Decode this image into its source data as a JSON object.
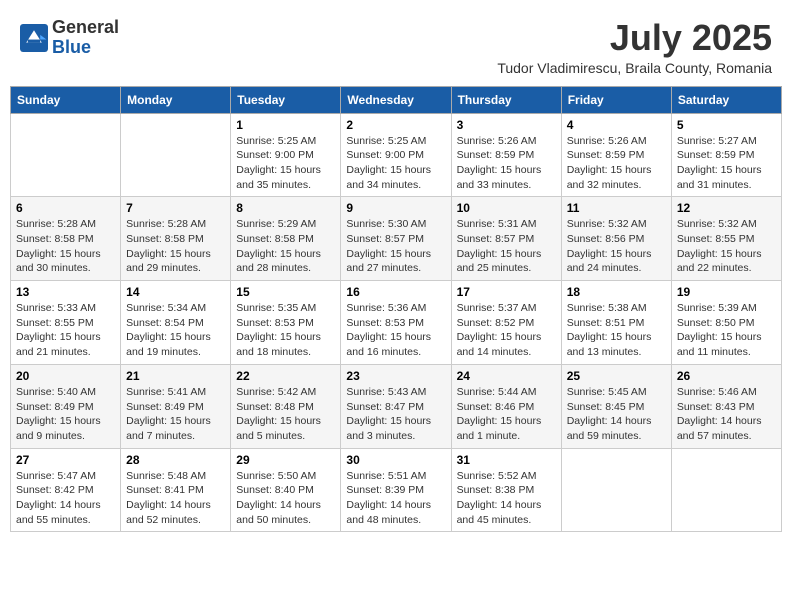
{
  "logo": {
    "general": "General",
    "blue": "Blue"
  },
  "title": {
    "month": "July 2025",
    "location": "Tudor Vladimirescu, Braila County, Romania"
  },
  "weekdays": [
    "Sunday",
    "Monday",
    "Tuesday",
    "Wednesday",
    "Thursday",
    "Friday",
    "Saturday"
  ],
  "weeks": [
    [
      {
        "day": null,
        "sunrise": null,
        "sunset": null,
        "daylight": null
      },
      {
        "day": null,
        "sunrise": null,
        "sunset": null,
        "daylight": null
      },
      {
        "day": "1",
        "sunrise": "Sunrise: 5:25 AM",
        "sunset": "Sunset: 9:00 PM",
        "daylight": "Daylight: 15 hours and 35 minutes."
      },
      {
        "day": "2",
        "sunrise": "Sunrise: 5:25 AM",
        "sunset": "Sunset: 9:00 PM",
        "daylight": "Daylight: 15 hours and 34 minutes."
      },
      {
        "day": "3",
        "sunrise": "Sunrise: 5:26 AM",
        "sunset": "Sunset: 8:59 PM",
        "daylight": "Daylight: 15 hours and 33 minutes."
      },
      {
        "day": "4",
        "sunrise": "Sunrise: 5:26 AM",
        "sunset": "Sunset: 8:59 PM",
        "daylight": "Daylight: 15 hours and 32 minutes."
      },
      {
        "day": "5",
        "sunrise": "Sunrise: 5:27 AM",
        "sunset": "Sunset: 8:59 PM",
        "daylight": "Daylight: 15 hours and 31 minutes."
      }
    ],
    [
      {
        "day": "6",
        "sunrise": "Sunrise: 5:28 AM",
        "sunset": "Sunset: 8:58 PM",
        "daylight": "Daylight: 15 hours and 30 minutes."
      },
      {
        "day": "7",
        "sunrise": "Sunrise: 5:28 AM",
        "sunset": "Sunset: 8:58 PM",
        "daylight": "Daylight: 15 hours and 29 minutes."
      },
      {
        "day": "8",
        "sunrise": "Sunrise: 5:29 AM",
        "sunset": "Sunset: 8:58 PM",
        "daylight": "Daylight: 15 hours and 28 minutes."
      },
      {
        "day": "9",
        "sunrise": "Sunrise: 5:30 AM",
        "sunset": "Sunset: 8:57 PM",
        "daylight": "Daylight: 15 hours and 27 minutes."
      },
      {
        "day": "10",
        "sunrise": "Sunrise: 5:31 AM",
        "sunset": "Sunset: 8:57 PM",
        "daylight": "Daylight: 15 hours and 25 minutes."
      },
      {
        "day": "11",
        "sunrise": "Sunrise: 5:32 AM",
        "sunset": "Sunset: 8:56 PM",
        "daylight": "Daylight: 15 hours and 24 minutes."
      },
      {
        "day": "12",
        "sunrise": "Sunrise: 5:32 AM",
        "sunset": "Sunset: 8:55 PM",
        "daylight": "Daylight: 15 hours and 22 minutes."
      }
    ],
    [
      {
        "day": "13",
        "sunrise": "Sunrise: 5:33 AM",
        "sunset": "Sunset: 8:55 PM",
        "daylight": "Daylight: 15 hours and 21 minutes."
      },
      {
        "day": "14",
        "sunrise": "Sunrise: 5:34 AM",
        "sunset": "Sunset: 8:54 PM",
        "daylight": "Daylight: 15 hours and 19 minutes."
      },
      {
        "day": "15",
        "sunrise": "Sunrise: 5:35 AM",
        "sunset": "Sunset: 8:53 PM",
        "daylight": "Daylight: 15 hours and 18 minutes."
      },
      {
        "day": "16",
        "sunrise": "Sunrise: 5:36 AM",
        "sunset": "Sunset: 8:53 PM",
        "daylight": "Daylight: 15 hours and 16 minutes."
      },
      {
        "day": "17",
        "sunrise": "Sunrise: 5:37 AM",
        "sunset": "Sunset: 8:52 PM",
        "daylight": "Daylight: 15 hours and 14 minutes."
      },
      {
        "day": "18",
        "sunrise": "Sunrise: 5:38 AM",
        "sunset": "Sunset: 8:51 PM",
        "daylight": "Daylight: 15 hours and 13 minutes."
      },
      {
        "day": "19",
        "sunrise": "Sunrise: 5:39 AM",
        "sunset": "Sunset: 8:50 PM",
        "daylight": "Daylight: 15 hours and 11 minutes."
      }
    ],
    [
      {
        "day": "20",
        "sunrise": "Sunrise: 5:40 AM",
        "sunset": "Sunset: 8:49 PM",
        "daylight": "Daylight: 15 hours and 9 minutes."
      },
      {
        "day": "21",
        "sunrise": "Sunrise: 5:41 AM",
        "sunset": "Sunset: 8:49 PM",
        "daylight": "Daylight: 15 hours and 7 minutes."
      },
      {
        "day": "22",
        "sunrise": "Sunrise: 5:42 AM",
        "sunset": "Sunset: 8:48 PM",
        "daylight": "Daylight: 15 hours and 5 minutes."
      },
      {
        "day": "23",
        "sunrise": "Sunrise: 5:43 AM",
        "sunset": "Sunset: 8:47 PM",
        "daylight": "Daylight: 15 hours and 3 minutes."
      },
      {
        "day": "24",
        "sunrise": "Sunrise: 5:44 AM",
        "sunset": "Sunset: 8:46 PM",
        "daylight": "Daylight: 15 hours and 1 minute."
      },
      {
        "day": "25",
        "sunrise": "Sunrise: 5:45 AM",
        "sunset": "Sunset: 8:45 PM",
        "daylight": "Daylight: 14 hours and 59 minutes."
      },
      {
        "day": "26",
        "sunrise": "Sunrise: 5:46 AM",
        "sunset": "Sunset: 8:43 PM",
        "daylight": "Daylight: 14 hours and 57 minutes."
      }
    ],
    [
      {
        "day": "27",
        "sunrise": "Sunrise: 5:47 AM",
        "sunset": "Sunset: 8:42 PM",
        "daylight": "Daylight: 14 hours and 55 minutes."
      },
      {
        "day": "28",
        "sunrise": "Sunrise: 5:48 AM",
        "sunset": "Sunset: 8:41 PM",
        "daylight": "Daylight: 14 hours and 52 minutes."
      },
      {
        "day": "29",
        "sunrise": "Sunrise: 5:50 AM",
        "sunset": "Sunset: 8:40 PM",
        "daylight": "Daylight: 14 hours and 50 minutes."
      },
      {
        "day": "30",
        "sunrise": "Sunrise: 5:51 AM",
        "sunset": "Sunset: 8:39 PM",
        "daylight": "Daylight: 14 hours and 48 minutes."
      },
      {
        "day": "31",
        "sunrise": "Sunrise: 5:52 AM",
        "sunset": "Sunset: 8:38 PM",
        "daylight": "Daylight: 14 hours and 45 minutes."
      },
      {
        "day": null,
        "sunrise": null,
        "sunset": null,
        "daylight": null
      },
      {
        "day": null,
        "sunrise": null,
        "sunset": null,
        "daylight": null
      }
    ]
  ]
}
